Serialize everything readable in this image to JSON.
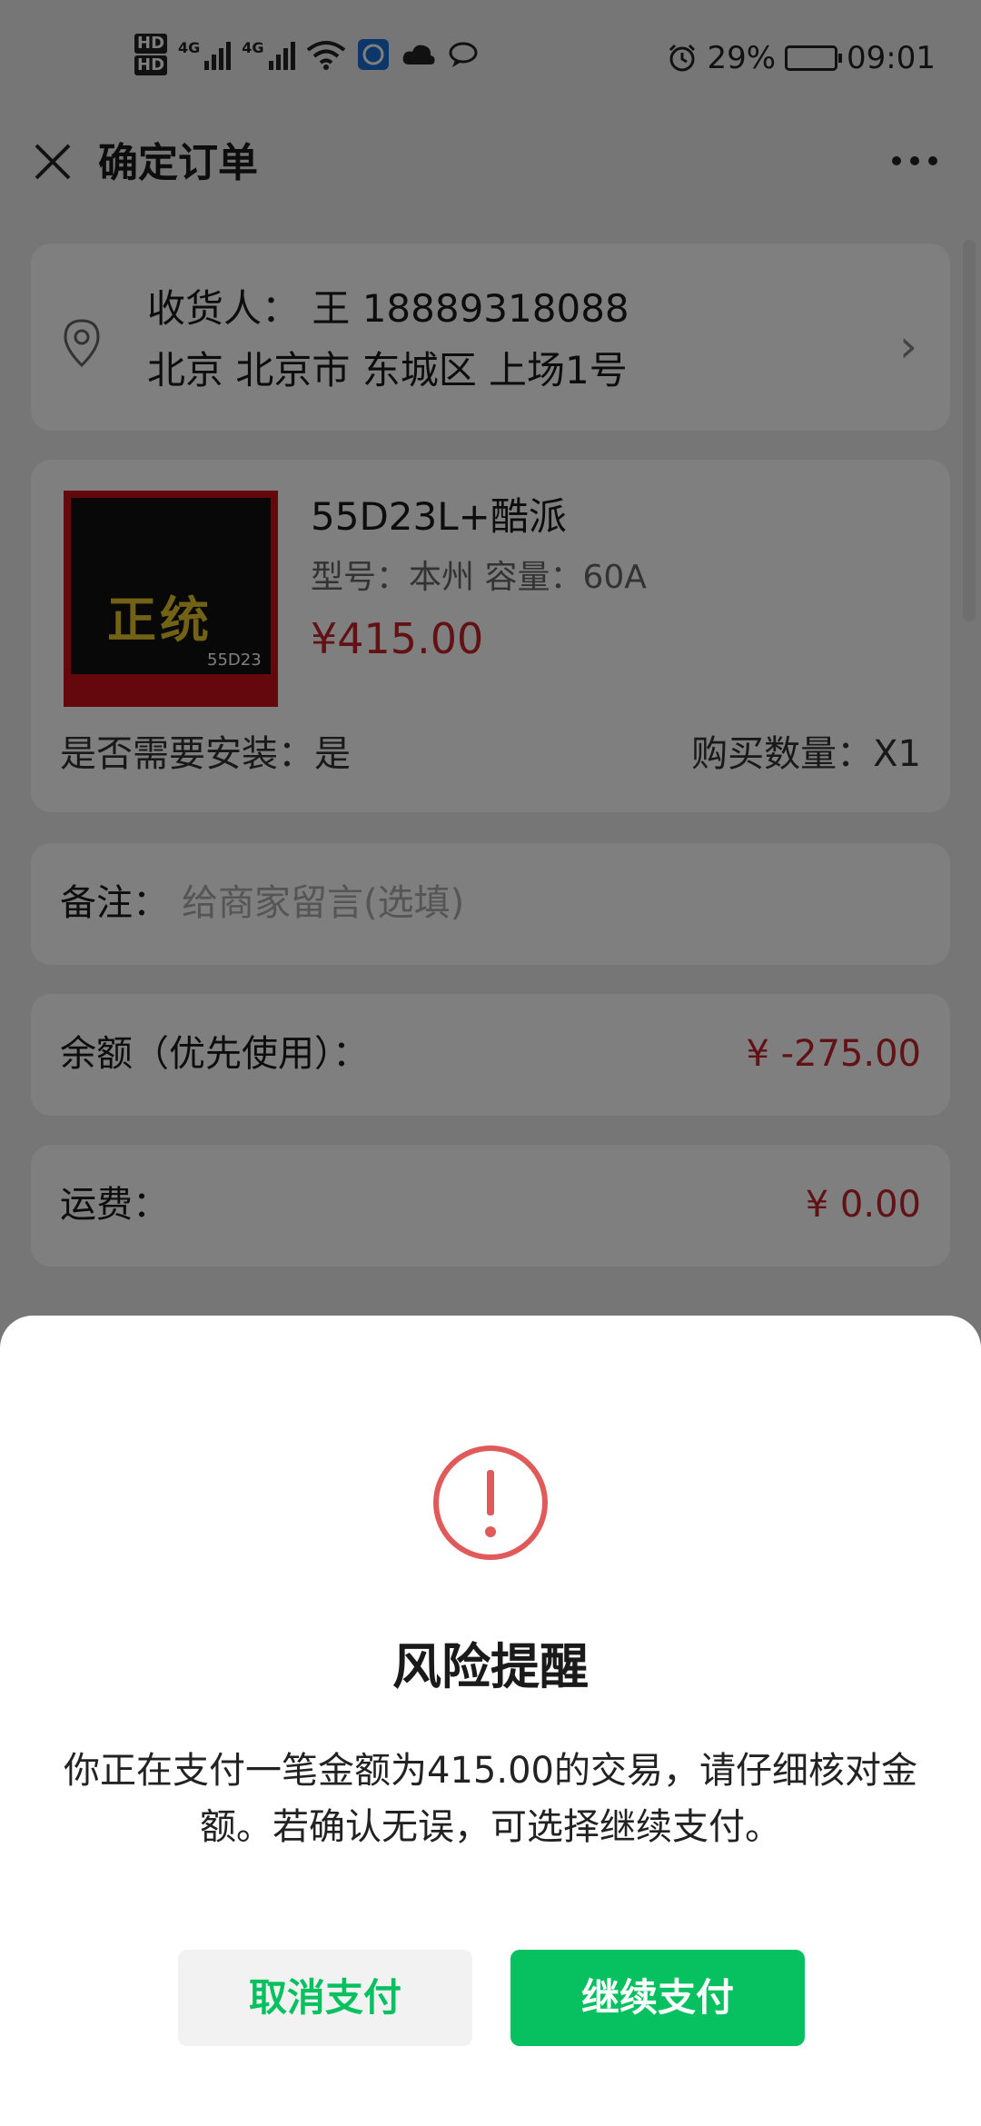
{
  "status_bar": {
    "hd1": "HD",
    "hd2": "HD",
    "net1": "4G",
    "net2": "4G",
    "battery_percent": "29%",
    "time": "09:01"
  },
  "header": {
    "title": "确定订单"
  },
  "address": {
    "line1": "收货人： 王 18889318088",
    "line2": "北京 北京市 东城区 上场1号"
  },
  "product": {
    "image_brand": "正统",
    "image_model": "55D23",
    "name": "55D23L+酷派",
    "spec": "型号：本州 容量：60A",
    "price": "¥415.00",
    "install": "是否需要安装：是",
    "quantity": "购买数量：X1"
  },
  "remark": {
    "label": "备注：",
    "placeholder": "给商家留言(选填)"
  },
  "balance": {
    "label": "余额（优先使用）：",
    "value": "¥ -275.00"
  },
  "freight": {
    "label": "运费：",
    "value": "¥ 0.00"
  },
  "dialog": {
    "title": "风险提醒",
    "message": "你正在支付一笔金额为415.00的交易，请仔细核对金额。若确认无误，可选择继续支付。",
    "cancel_label": "取消支付",
    "continue_label": "继续支付"
  },
  "colors": {
    "accent_green": "#07c160",
    "price_red": "#c4232b",
    "warning_red": "#e05a5a"
  }
}
